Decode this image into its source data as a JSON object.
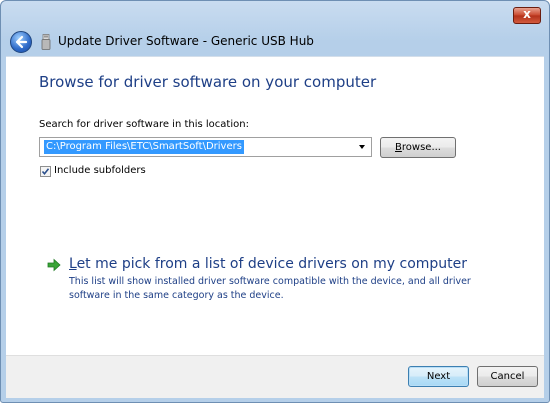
{
  "window": {
    "title": "Update Driver Software - Generic USB Hub",
    "close_glyph": "x"
  },
  "icons": {
    "back": "back-arrow-icon",
    "device": "usb-device-icon",
    "link_arrow": "green-arrow-icon",
    "combo_arrow": "chevron-down-icon",
    "check": "checkmark-icon"
  },
  "main": {
    "heading": "Browse for driver software on your computer",
    "search_label": "Search for driver software in this location:",
    "path_value": "C:\\Program Files\\ETC\\SmartSoft\\Drivers",
    "browse_label_u": "B",
    "browse_label_rest": "rowse...",
    "include_subfolders": {
      "label": "Include subfolders",
      "checked": true
    },
    "pick_link": {
      "label_u": "L",
      "label_rest": "et me pick from a list of device drivers on my computer",
      "description": "This list will show installed driver software compatible with the device, and all driver software in the same category as the device."
    }
  },
  "footer": {
    "next_label": "Next",
    "cancel_label": "Cancel"
  },
  "colors": {
    "heading": "#1e3f86",
    "selection": "#3399ff",
    "chrome": "#b5cfe9"
  }
}
